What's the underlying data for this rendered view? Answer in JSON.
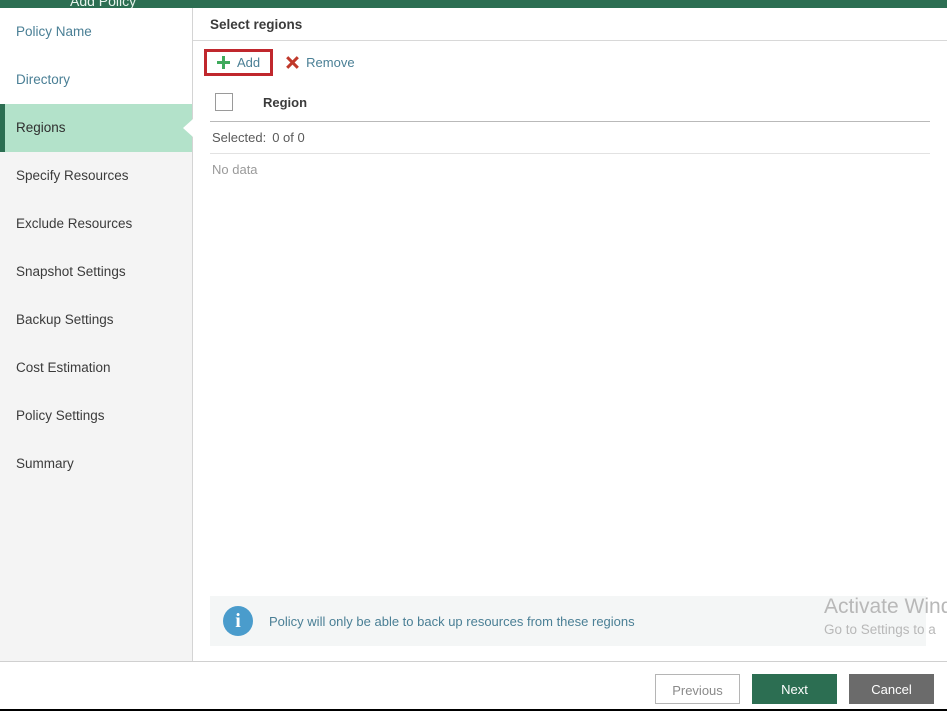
{
  "window": {
    "title_fragment": "Add Policy",
    "titlebar_color": "#2c6e52"
  },
  "sidebar": {
    "items": [
      {
        "label": "Policy Name",
        "state": "done"
      },
      {
        "label": "Directory",
        "state": "done"
      },
      {
        "label": "Regions",
        "state": "active"
      },
      {
        "label": "Specify Resources",
        "state": "pending"
      },
      {
        "label": "Exclude Resources",
        "state": "pending"
      },
      {
        "label": "Snapshot Settings",
        "state": "pending"
      },
      {
        "label": "Backup Settings",
        "state": "pending"
      },
      {
        "label": "Cost Estimation",
        "state": "pending"
      },
      {
        "label": "Policy Settings",
        "state": "pending"
      },
      {
        "label": "Summary",
        "state": "pending"
      }
    ],
    "active_color": "#b3e2ca",
    "active_bar_color": "#2c6e52",
    "done_color": "#4a7f95"
  },
  "content": {
    "header_title": "Select regions",
    "toolbar": {
      "add_label": "Add",
      "remove_label": "Remove",
      "add_highlight_color": "#c0272d",
      "add_icon_color": "#3faa5c",
      "remove_icon_color": "#c0392b"
    },
    "table": {
      "checkbox_checked": false,
      "column_header": "Region",
      "selected_label": "Selected:",
      "selected_value": "0 of 0",
      "empty_text": "No data"
    },
    "info": {
      "icon": "info-icon",
      "message": "Policy will only be able to back up resources from these regions",
      "icon_color": "#4a9ccc"
    }
  },
  "watermark": {
    "title": "Activate Wind",
    "subtitle": "Go to Settings to a"
  },
  "footer": {
    "previous_label": "Previous",
    "next_label": "Next",
    "cancel_label": "Cancel",
    "next_color": "#2c6e52",
    "cancel_color": "#6b6b6b"
  }
}
